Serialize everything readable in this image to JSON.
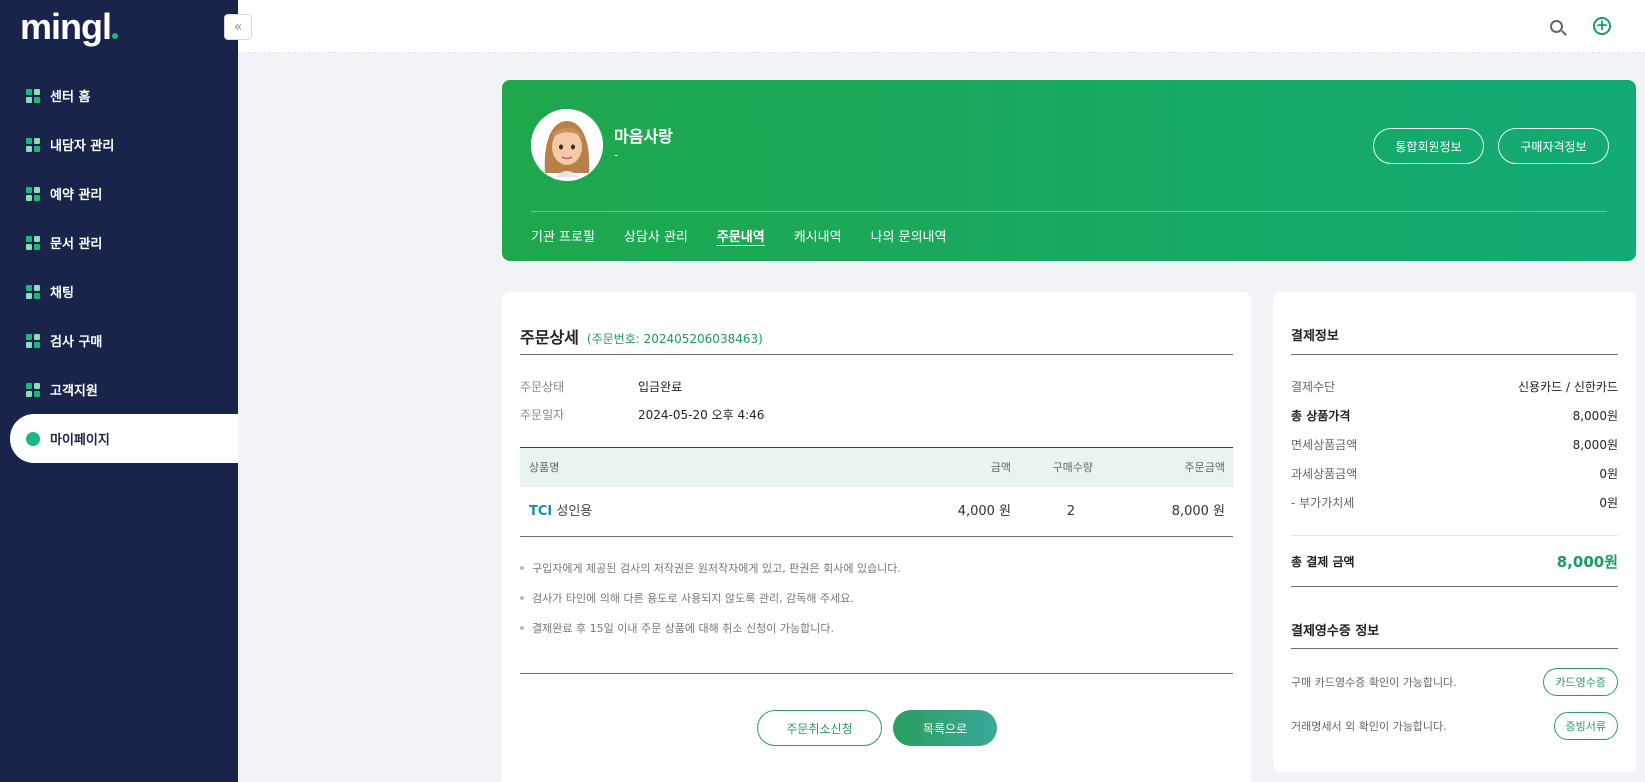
{
  "brand": {
    "logo": "mingl"
  },
  "sidebar": {
    "collapse_glyph": "«",
    "items": [
      {
        "label": "센터 홈",
        "icon": "home-icon"
      },
      {
        "label": "내담자 관리",
        "icon": "client-icon"
      },
      {
        "label": "예약 관리",
        "icon": "reservation-icon"
      },
      {
        "label": "문서 관리",
        "icon": "document-icon"
      },
      {
        "label": "채팅",
        "icon": "chat-icon"
      },
      {
        "label": "검사 구매",
        "icon": "purchase-icon"
      },
      {
        "label": "고객지원",
        "icon": "support-icon"
      },
      {
        "label": "마이페이지",
        "icon": "user-icon",
        "active": true
      }
    ]
  },
  "topbar": {
    "plus_glyph": "+"
  },
  "profile": {
    "name": "마음사랑",
    "sub": "-",
    "buttons": {
      "member_info": "통합회원정보",
      "buyer_info": "구매자격정보"
    },
    "tabs": [
      "기관 프로필",
      "상담사 관리",
      "주문내역",
      "캐시내역",
      "나의 문의내역"
    ],
    "active_tab": "주문내역"
  },
  "order": {
    "title": "주문상세",
    "number_text": "(주문번호: 202405206038463)",
    "status_label": "주문상태",
    "status_value": "입금완료",
    "date_label": "주문일자",
    "date_value": "2024-05-20 오후 4:46",
    "table": {
      "headers": {
        "name": "상품명",
        "price": "금액",
        "qty": "구매수량",
        "total": "주문금액"
      },
      "rows": [
        {
          "code": "TCI",
          "name": "성인용",
          "price": "4,000 원",
          "qty": "2",
          "total": "8,000 원"
        }
      ]
    },
    "notes": [
      "구입자에게 제공된 검사의 저작권은 원저작자에게 있고, 판권은 회사에 있습니다.",
      "검사가 타인에 의해 다른 용도로 사용되지 않도록 관리, 감독해 주세요.",
      "결제완료 후 15일 이내 주문 상품에 대해 취소 신청이 가능합니다."
    ],
    "buttons": {
      "cancel": "주문취소신청",
      "list": "목록으로"
    }
  },
  "payment": {
    "title": "결제정보",
    "rows": [
      {
        "label": "결제수단",
        "value": "신용카드 / 신한카드"
      },
      {
        "label": "총 상품가격",
        "value": "8,000원"
      },
      {
        "label": "면세상품금액",
        "value": "8,000원"
      },
      {
        "label": "과세상품금액",
        "value": "0원"
      },
      {
        "label": "- 부가가치세",
        "value": "0원"
      }
    ],
    "total_label": "총 결제 금액",
    "total_value": "8,000원",
    "receipt_title": "결제영수증 정보",
    "receipt_rows": [
      {
        "text": "구매 카드영수증 확인이 가능합니다.",
        "button": "카드영수증"
      },
      {
        "text": "거래명세서 외 확인이 가능합니다.",
        "button": "증빙서류"
      }
    ]
  },
  "colors": {
    "sidebar": "#182449",
    "accent": "#1a9c5f",
    "banner_start": "#1fa74c",
    "banner_end": "#12ab75"
  }
}
